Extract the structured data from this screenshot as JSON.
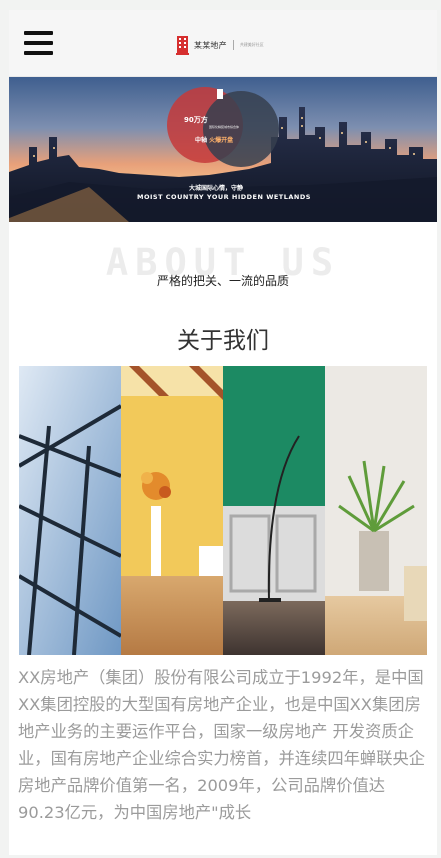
{
  "header": {
    "logo_name": "某某地产",
    "logo_slogan": "共建美好社区",
    "menu_icon": "hamburger-menu-icon",
    "logo_icon": "building-icon",
    "accent_color": "#d62f2f"
  },
  "banner": {
    "price_text": "90万方",
    "price_sub": "国际化精装城市综合体",
    "open_prefix": "中轴",
    "open_highlight": "火爆开盘",
    "slogan_cn": "大城国际心情，守静",
    "slogan_en": "MOIST COUNTRY YOUR HIDDEN WETLANDS"
  },
  "about": {
    "ghost_text": "ABOUT US",
    "tagline": "严格的把关、一流的品质",
    "title": "关于我们",
    "body": "XX房地产（集团）股份有限公司成立于1992年，是中国XX集团控股的大型国有房地产企业，也是中国XX集团房地产业务的主要运作平台，国家一级房地产 开发资质企业，国有房地产企业综合实力榜首，并连续四年蝉联央企房地产品牌价值第一名，2009年，公司品牌价值达90.23亿元，为中国房地产\"成长"
  }
}
